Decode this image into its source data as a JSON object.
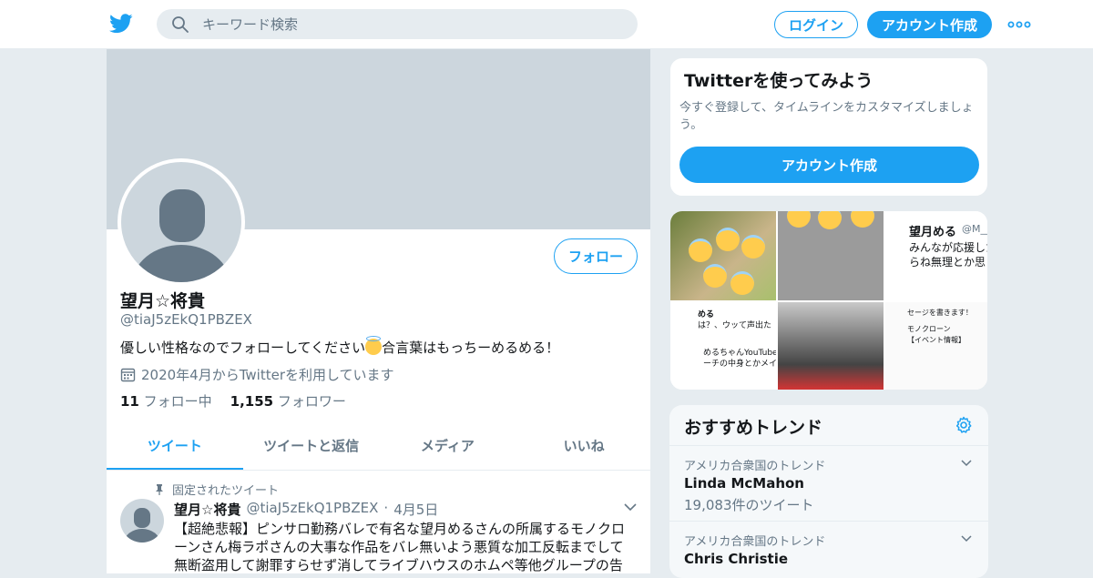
{
  "nav": {
    "search_placeholder": "キーワード検索",
    "login_label": "ログイン",
    "signup_label": "アカウント作成"
  },
  "profile": {
    "name": "望月☆将貴",
    "handle": "@tiaJ5zEkQ1PBZEX",
    "follow_label": "フォロー",
    "bio_before": "優しい性格なのでフォローしてください",
    "bio_after": "合言葉はもっちーめるめる！",
    "joined": "2020年4月からTwitterを利用しています",
    "following_count": "11",
    "following_label": "フォロー中",
    "followers_count": "1,155",
    "followers_label": "フォロワー"
  },
  "tabs": [
    "ツイート",
    "ツイートと返信",
    "メディア",
    "いいね"
  ],
  "pinned_tweet": {
    "pinned_label": "固定されたツイート",
    "name": "望月☆将貴",
    "handle": "@tiaJ5zEkQ1PBZEX",
    "dot": "·",
    "date": "4月5日",
    "text": "【超絶悲報】ピンサロ勤務バレで有名な望月めるさんの所属するモノクローンさん梅ラポさんの大事な作品をバレ無いよう悪質な加工反転までして無断盗用して謝罪すらせず消してライブハウスのホムペ等他グループの告"
  },
  "signup_card": {
    "title": "Twitterを使ってみよう",
    "description": "今すぐ登録して、タイムラインをカスタマイズしましょう。",
    "button_label": "アカウント作成"
  },
  "media": {
    "tile3_name": "望月める",
    "tile3_handle": "@M___U",
    "tile3_line1": "みんなが応援した",
    "tile3_line2": "らね無理とか思っ",
    "tile4_name": "める",
    "tile4_line1": "は？、ウッて声出た",
    "tile4_line2": "めるちゃんYouTube始め",
    "tile4_line3": "ーチの中身とかメイク動",
    "tile6_line1": "セージを書きます！",
    "tile6_line2": "モノクローン",
    "tile6_line3": "【イベント情報】"
  },
  "trends": {
    "title": "おすすめトレンド",
    "items": [
      {
        "location": "アメリカ合衆国のトレンド",
        "topic": "Linda McMahon",
        "count": "19,083件のツイート"
      },
      {
        "location": "アメリカ合衆国のトレンド",
        "topic": "Chris Christie",
        "count": ""
      }
    ]
  },
  "colors": {
    "accent": "#1da1f2",
    "text_primary": "#14171a",
    "text_secondary": "#657786",
    "background": "#e6ecf0",
    "banner": "#ccd6dd"
  }
}
